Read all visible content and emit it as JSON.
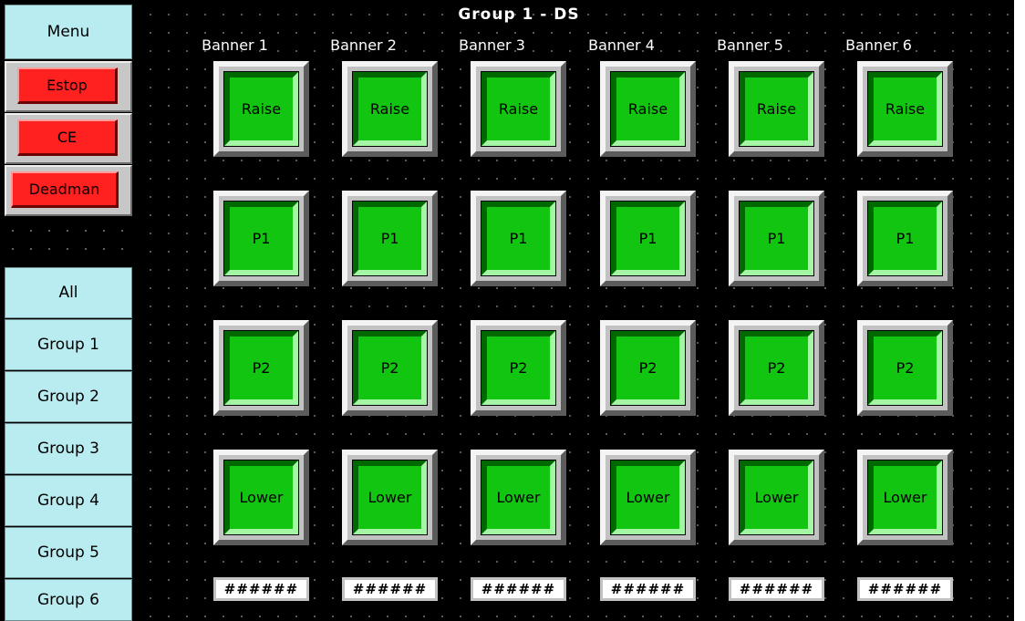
{
  "sidebar": {
    "menu_label": "Menu",
    "estop_label": "Estop",
    "ce_label": "CE",
    "deadman_label": "Deadman",
    "groups": [
      "All",
      "Group 1",
      "Group 2",
      "Group 3",
      "Group 4",
      "Group 5",
      "Group 6"
    ]
  },
  "title": "Group 1 - DS",
  "banners": [
    {
      "label": "Banner 1",
      "raise": "Raise",
      "p1": "P1",
      "p2": "P2",
      "lower": "Lower",
      "value": "######"
    },
    {
      "label": "Banner 2",
      "raise": "Raise",
      "p1": "P1",
      "p2": "P2",
      "lower": "Lower",
      "value": "######"
    },
    {
      "label": "Banner 3",
      "raise": "Raise",
      "p1": "P1",
      "p2": "P2",
      "lower": "Lower",
      "value": "######"
    },
    {
      "label": "Banner 4",
      "raise": "Raise",
      "p1": "P1",
      "p2": "P2",
      "lower": "Lower",
      "value": "######"
    },
    {
      "label": "Banner 5",
      "raise": "Raise",
      "p1": "P1",
      "p2": "P2",
      "lower": "Lower",
      "value": "######"
    },
    {
      "label": "Banner 6",
      "raise": "Raise",
      "p1": "P1",
      "p2": "P2",
      "lower": "Lower",
      "value": "######"
    }
  ],
  "colors": {
    "button_green": "#11c511",
    "sidebar_cyan": "#b9ecf0",
    "estop_red": "#ff2020",
    "background": "#000000"
  }
}
